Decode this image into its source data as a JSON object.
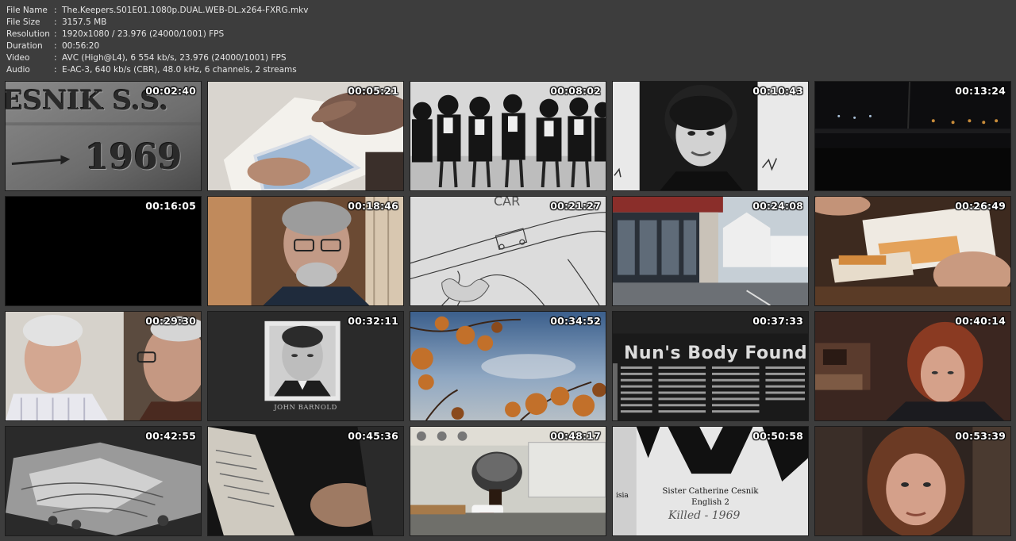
{
  "info": [
    {
      "label": "File Name",
      "value": "The.Keepers.S01E01.1080p.DUAL.WEB-DL.x264-FXRG.mkv"
    },
    {
      "label": "File Size",
      "value": "3157.5 MB"
    },
    {
      "label": "Resolution",
      "value": "1920x1080 / 23.976 (24000/1001) FPS"
    },
    {
      "label": "Duration",
      "value": "00:56:20"
    },
    {
      "label": "Video",
      "value": "AVC (High@L4), 6 554 kb/s, 23.976 (24000/1001) FPS"
    },
    {
      "label": "Audio",
      "value": "E-AC-3, 640 kb/s (CBR), 48.0 kHz, 6 channels, 2 streams"
    }
  ],
  "separator": ":",
  "thumbnails": [
    {
      "time": "00:02:40",
      "carved_name": "ESNIK S.S.",
      "carved_year": "1969"
    },
    {
      "time": "00:05:21"
    },
    {
      "time": "00:08:02"
    },
    {
      "time": "00:10:43"
    },
    {
      "time": "00:13:24"
    },
    {
      "time": "00:16:05"
    },
    {
      "time": "00:18:46"
    },
    {
      "time": "00:21:27",
      "sketch_label": "CAR"
    },
    {
      "time": "00:24:08"
    },
    {
      "time": "00:26:49"
    },
    {
      "time": "00:29:30"
    },
    {
      "time": "00:32:11",
      "caption": "JOHN BARNOLD"
    },
    {
      "time": "00:34:52"
    },
    {
      "time": "00:37:33",
      "headline": "Nun's Body Found I"
    },
    {
      "time": "00:40:14"
    },
    {
      "time": "00:42:55"
    },
    {
      "time": "00:45:36"
    },
    {
      "time": "00:48:17"
    },
    {
      "time": "00:50:58",
      "name": "Sister Catherine Cesnik",
      "class": "English 2",
      "handwritten": "Killed - 1969",
      "side_text": "isia"
    },
    {
      "time": "00:53:39"
    }
  ]
}
